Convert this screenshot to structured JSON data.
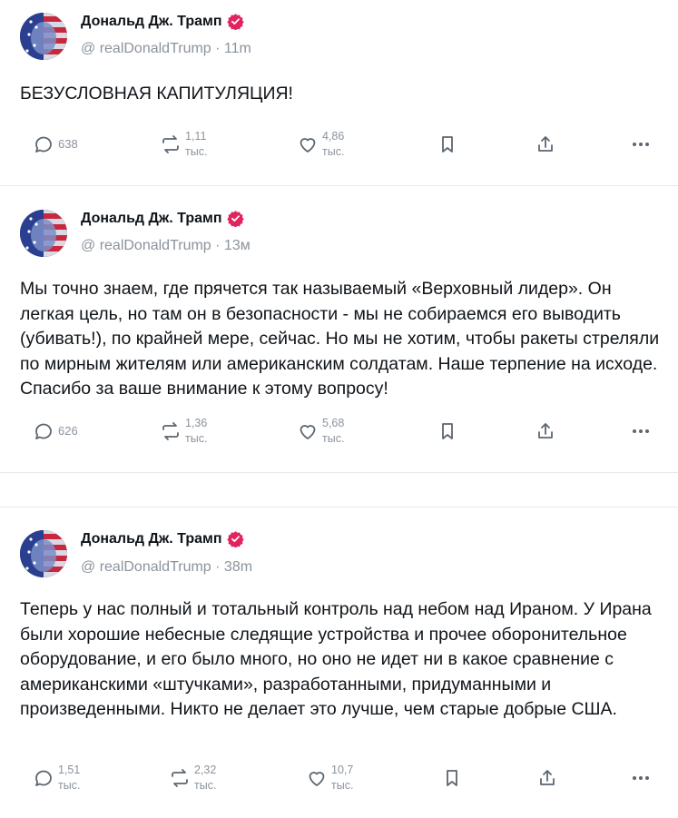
{
  "author": {
    "display_name": "Дональд Дж. Трамп",
    "verified_icon": "verified-badge-icon",
    "badge_color": "#e0245e",
    "avatar": "avatar-flag-portrait"
  },
  "posts": [
    {
      "handle": "@ realDonaldTrump · 11m",
      "text": "БЕЗУСЛОВНАЯ КАПИТУЛЯЦИЯ!",
      "replies": "638",
      "reposts": [
        "1,11",
        "тыс."
      ],
      "likes": [
        "4,86",
        "тыс."
      ]
    },
    {
      "handle": "@ realDonaldTrump · 13м",
      "text": "Мы точно знаем, где прячется так называемый «Верховный лидер». Он легкая цель, но там он в безопасности - мы не собираемся его выводить (убивать!), по крайней мере, сейчас. Но мы не хотим, чтобы ракеты стреляли по мирным жителям или американским солдатам. Наше терпение на исходе. Спасибо за ваше внимание к этому вопросу!",
      "replies": "626",
      "reposts": [
        "1,36",
        "тыс."
      ],
      "likes": [
        "5,68",
        "тыс."
      ]
    },
    {
      "handle": "@ realDonaldTrump · 38m",
      "text": "Теперь у нас полный и тотальный контроль над небом над Ираном. У Ирана были хорошие небесные следящие устройства и прочее оборонительное оборудование, и его было много, но оно не идет ни в какое сравнение с американскими «штучками», разработанными, придуманными и произведенными. Никто не делает это лучше, чем старые добрые США.",
      "replies": [
        "1,51",
        "тыс."
      ],
      "reposts": [
        "2,32",
        "тыс."
      ],
      "likes": [
        "10,7",
        "тыс."
      ]
    }
  ],
  "icons": {
    "reply": "reply-bubble-icon",
    "repost": "repost-arrows-icon",
    "like": "heart-icon",
    "bookmark": "bookmark-icon",
    "share": "share-upload-icon",
    "more": "more-dots-icon"
  }
}
